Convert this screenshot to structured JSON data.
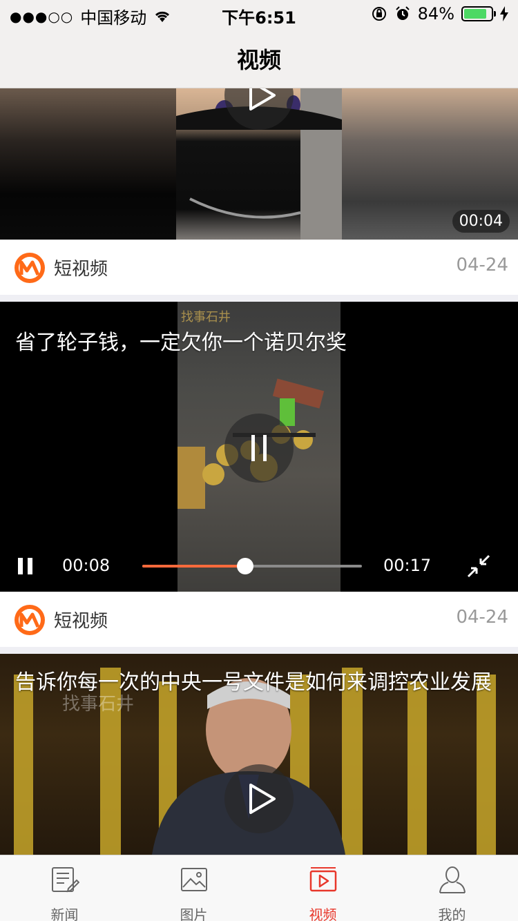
{
  "status_bar": {
    "signal": "●●●○○",
    "carrier": "中国移动",
    "time": "下午6:51",
    "battery_percent_label": "84%",
    "battery_level": 0.84
  },
  "nav": {
    "title": "视频"
  },
  "feed": [
    {
      "duration": "00:04",
      "source": "短视频",
      "date": "04-24"
    },
    {
      "caption": "省了轮子钱，一定欠你一个诺贝尔奖",
      "elapsed": "00:08",
      "total": "00:17",
      "progress": 0.47,
      "watermark": "找事石井",
      "source": "短视频",
      "date": "04-24"
    },
    {
      "caption": "告诉你每一次的中央一号文件是如何来调控农业发展",
      "watermark": "找事石井"
    }
  ],
  "tabs": [
    {
      "label": "新闻",
      "icon": "news-icon"
    },
    {
      "label": "图片",
      "icon": "picture-icon"
    },
    {
      "label": "视频",
      "icon": "video-icon"
    },
    {
      "label": "我的",
      "icon": "profile-icon"
    }
  ],
  "colors": {
    "accent_orange": "#ff6a3c",
    "tab_active_red": "#e8362a",
    "battery_green": "#4cd964"
  }
}
